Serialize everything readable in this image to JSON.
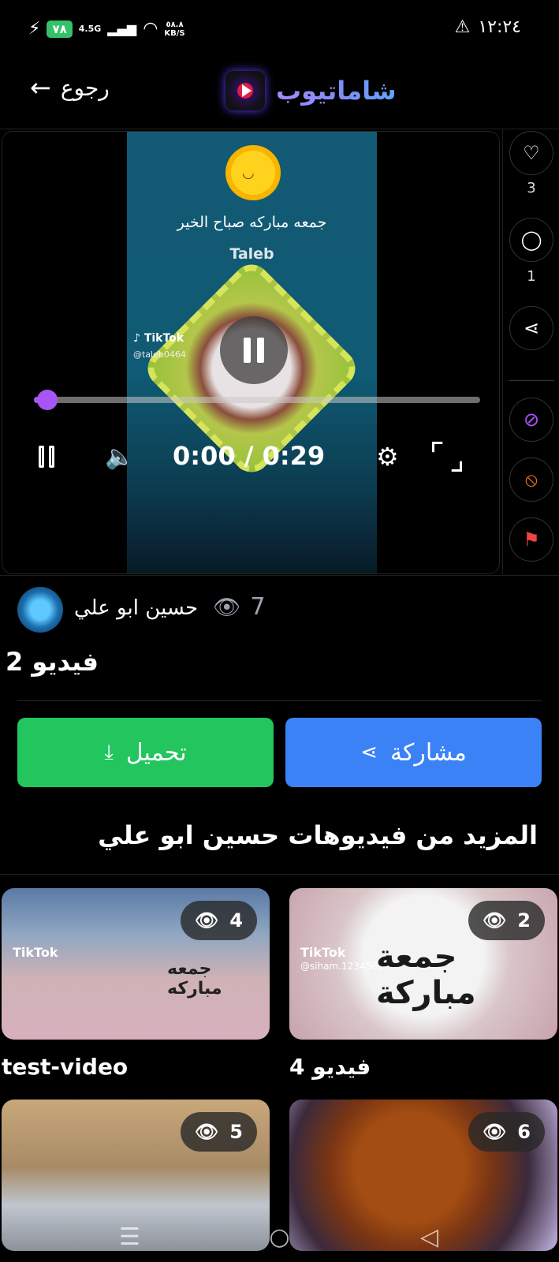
{
  "status_bar": {
    "battery": "٧٨",
    "network": "4.5G",
    "speed_value": "٥٨.٨",
    "speed_unit": "KB/S",
    "time": "١٢:٢٤"
  },
  "header": {
    "back_label": "رجوع",
    "app_name": "شاماتيوب"
  },
  "video": {
    "caption": "جمعه مباركه صباح الخير",
    "watermark_name": "Taleb",
    "tiktok_label": "TikTok",
    "tiktok_handle": "@taleb0464",
    "time_text": "0:00 / 0:29",
    "progress": 0.03
  },
  "side_actions": {
    "likes": "3",
    "comments": "1"
  },
  "post": {
    "author": "حسين ابو علي",
    "views": "7",
    "title": "فيديو 2"
  },
  "actions": {
    "download_label": "تحميل",
    "share_label": "مشاركة"
  },
  "more": {
    "title": "المزيد من فيديوهات حسين ابو علي",
    "cards": [
      {
        "title": "test-video",
        "views": "4",
        "overlay": "جمعه مباركه",
        "tiktok": "TikTok"
      },
      {
        "title": "فيديو 4",
        "views": "2",
        "overlay": "جمعة مباركة",
        "tiktok": "TikTok",
        "handle": "@siham.1234560"
      },
      {
        "title": "",
        "views": "5"
      },
      {
        "title": "",
        "views": "6"
      }
    ]
  },
  "icons": {
    "accent": "#a855f7",
    "download_color": "#22c55e",
    "share_color": "#3b82f6"
  }
}
